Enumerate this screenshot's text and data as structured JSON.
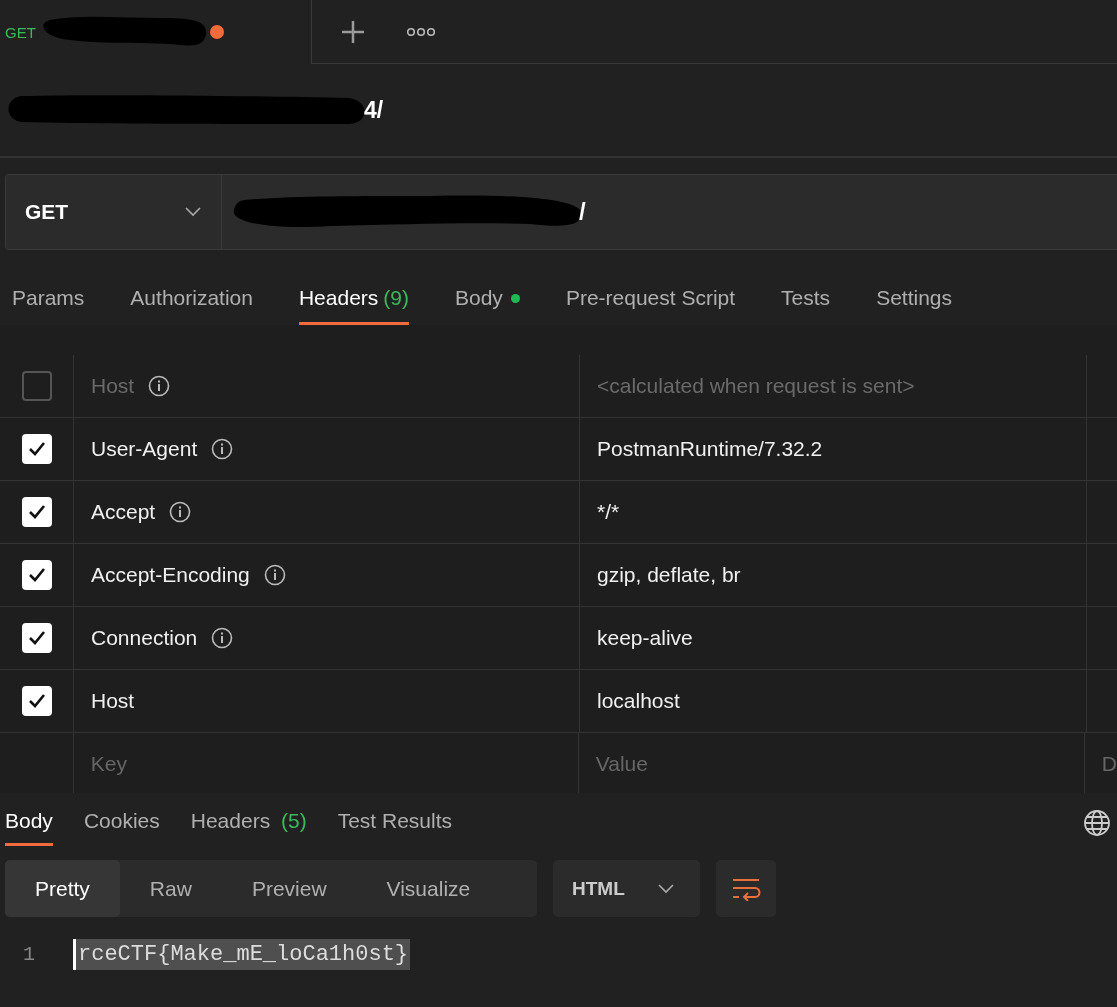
{
  "tab": {
    "method": "GET",
    "unsaved": true
  },
  "request_title": {
    "visible_text": "4/"
  },
  "request": {
    "method": "GET",
    "url_visible_text": "/"
  },
  "request_tabs": [
    {
      "label": "Params",
      "selected": false
    },
    {
      "label": "Authorization",
      "selected": false
    },
    {
      "label": "Headers",
      "count": "(9)",
      "selected": true
    },
    {
      "label": "Body",
      "has_content": true,
      "selected": false
    },
    {
      "label": "Pre-request Script",
      "selected": false
    },
    {
      "label": "Tests",
      "selected": false
    },
    {
      "label": "Settings",
      "selected": false
    }
  ],
  "headers": {
    "rows": [
      {
        "key": "Host",
        "value": "<calculated when request is sent>",
        "checked": false,
        "info": true
      },
      {
        "key": "User-Agent",
        "value": "PostmanRuntime/7.32.2",
        "checked": true,
        "info": true
      },
      {
        "key": "Accept",
        "value": "*/*",
        "checked": true,
        "info": true
      },
      {
        "key": "Accept-Encoding",
        "value": "gzip, deflate, br",
        "checked": true,
        "info": true
      },
      {
        "key": "Connection",
        "value": "keep-alive",
        "checked": true,
        "info": true
      },
      {
        "key": "Host",
        "value": "localhost",
        "checked": true,
        "info": false
      }
    ],
    "new_row": {
      "key_placeholder": "Key",
      "value_placeholder": "Value",
      "description_placeholder": "D"
    }
  },
  "response_tabs": [
    {
      "label": "Body",
      "selected": true
    },
    {
      "label": "Cookies",
      "selected": false
    },
    {
      "label": "Headers",
      "count": "(5)",
      "selected": false
    },
    {
      "label": "Test Results",
      "selected": false
    }
  ],
  "view_modes": [
    {
      "label": "Pretty",
      "selected": true
    },
    {
      "label": "Raw",
      "selected": false
    },
    {
      "label": "Preview",
      "selected": false
    },
    {
      "label": "Visualize",
      "selected": false
    }
  ],
  "format": "HTML",
  "body_lines": [
    {
      "number": "1",
      "text": "rceCTF{Make_mE_loCa1h0st}",
      "selected": true
    }
  ]
}
